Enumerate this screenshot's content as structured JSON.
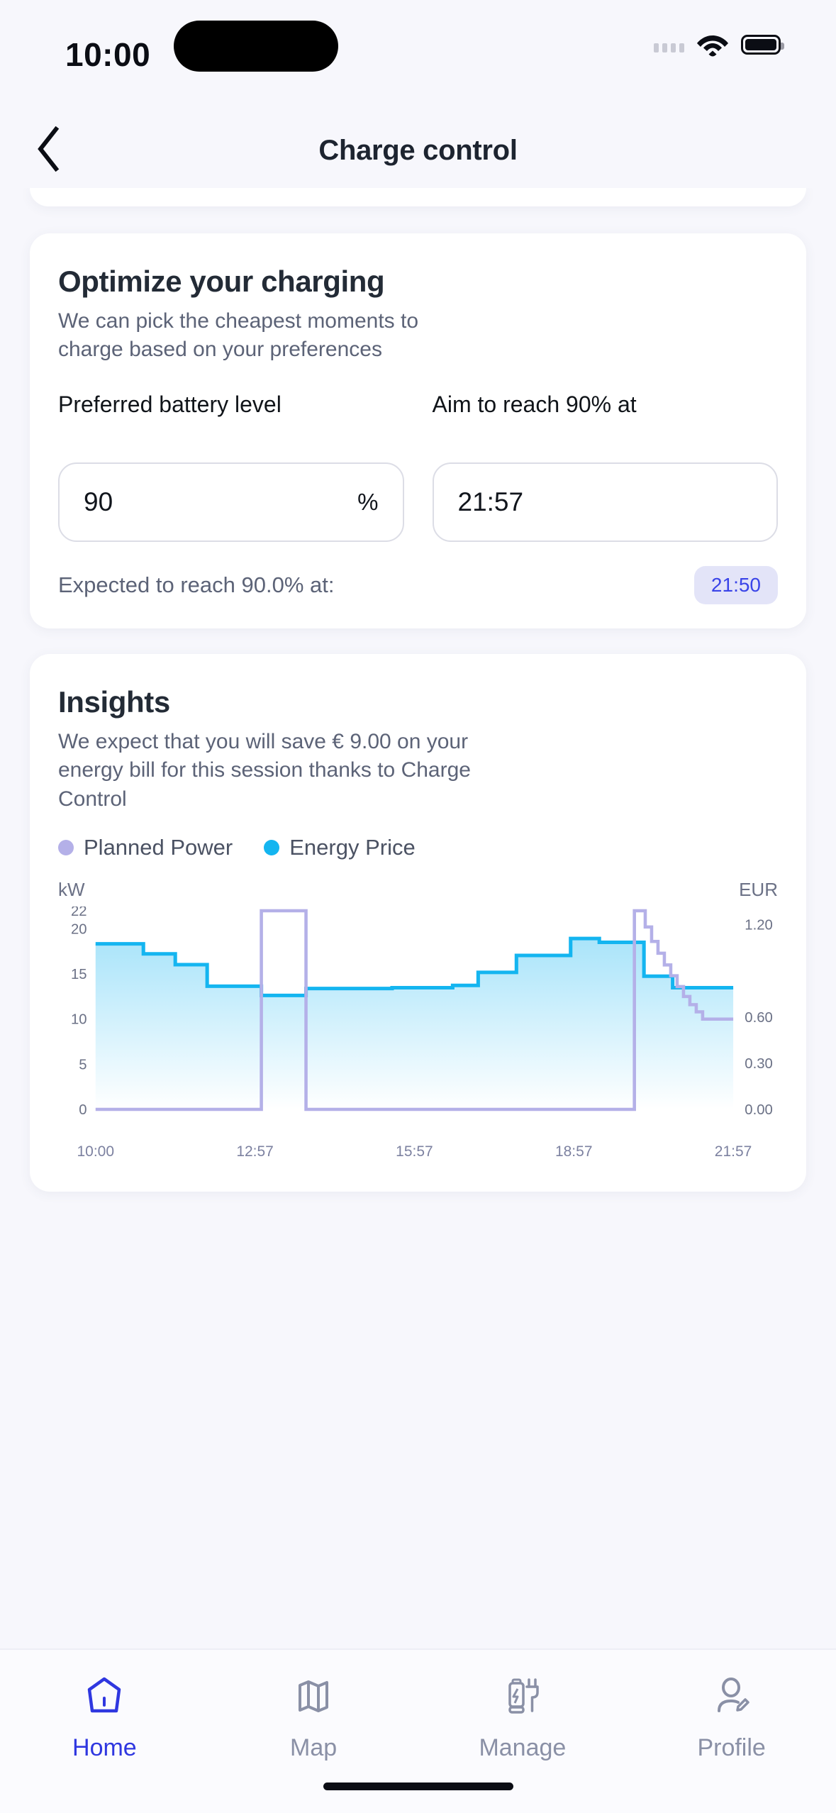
{
  "status_bar": {
    "time": "10:00",
    "icons": [
      "signal-dots-icon",
      "wifi-icon",
      "battery-icon"
    ]
  },
  "nav": {
    "back_icon": "chevron-left-icon",
    "title": "Charge control"
  },
  "optimize_card": {
    "title": "Optimize your charging",
    "subtitle": "We can pick the cheapest moments to charge based on your preferences",
    "battery_label": "Preferred battery level",
    "battery_value": "90",
    "battery_unit": "%",
    "aim_label": "Aim to reach 90% at",
    "aim_value": "21:57",
    "expected_text": "Expected to reach 90.0% at:",
    "expected_badge": "21:50",
    "badge_color": "#3a44e8",
    "badge_bg": "#e3e4f8"
  },
  "insights_card": {
    "title": "Insights",
    "subtitle": "We expect that you will save € 9.00 on your energy bill for this session thanks to Charge Control"
  },
  "chart_data": {
    "type": "area",
    "title": "",
    "legend": [
      {
        "name": "Planned Power",
        "color": "#b4b0e8"
      },
      {
        "name": "Energy Price",
        "color": "#14b5f0"
      }
    ],
    "legend_position": "top-left",
    "ylabel": "kW",
    "y2label": "EUR",
    "xlabel": "",
    "grid": false,
    "x_ticks": [
      "10:00",
      "12:57",
      "15:57",
      "18:57",
      "21:57"
    ],
    "x_tick_positions": [
      0.0,
      0.25,
      0.5,
      0.75,
      1.0
    ],
    "y_ticks": [
      0,
      5,
      10,
      15,
      20,
      22
    ],
    "y_tick_labels": [
      "0",
      "5",
      "10",
      "15",
      "20",
      "22"
    ],
    "ylim": [
      0,
      22
    ],
    "y2_ticks": [
      0.0,
      0.3,
      0.6,
      1.2
    ],
    "y2_tick_labels": [
      "0.00",
      "0.30",
      "0.60",
      "1.20"
    ],
    "y2lim": [
      0.0,
      1.29
    ],
    "series": [
      {
        "name": "Energy Price",
        "unit": "EUR",
        "axis": "right",
        "type": "step-area",
        "color": "#14b5f0",
        "fill_top": "#a9e4fa",
        "fill_bottom": "#ffffff",
        "x": [
          0.0,
          0.075,
          0.125,
          0.175,
          0.26,
          0.33,
          0.465,
          0.56,
          0.6,
          0.66,
          0.745,
          0.79,
          0.86,
          0.905,
          1.0
        ],
        "values": [
          1.075,
          1.01,
          0.94,
          0.8,
          0.74,
          0.785,
          0.79,
          0.805,
          0.89,
          1.0,
          1.11,
          1.085,
          0.865,
          0.79,
          0.79
        ]
      },
      {
        "name": "Planned Power",
        "unit": "kW",
        "axis": "left",
        "type": "step-line",
        "color": "#b4b0e8",
        "x": [
          0.0,
          0.26,
          0.26,
          0.33,
          0.33,
          0.845,
          0.845,
          0.862,
          0.872,
          0.882,
          0.892,
          0.902,
          0.912,
          0.922,
          0.932,
          0.942,
          0.952,
          1.0
        ],
        "values": [
          0.0,
          0.0,
          22.0,
          22.0,
          0.0,
          0.0,
          22.0,
          20.2,
          18.6,
          17.3,
          16.0,
          14.8,
          13.6,
          12.5,
          11.6,
          10.8,
          10.0,
          10.0
        ]
      }
    ]
  },
  "tabbar": {
    "items": [
      {
        "label": "Home",
        "icon": "home-icon",
        "active": true
      },
      {
        "label": "Map",
        "icon": "map-icon",
        "active": false
      },
      {
        "label": "Manage",
        "icon": "charger-plug-icon",
        "active": false
      },
      {
        "label": "Profile",
        "icon": "profile-edit-icon",
        "active": false
      }
    ],
    "active_color": "#2f37e0",
    "inactive_color": "#8a90a6"
  }
}
